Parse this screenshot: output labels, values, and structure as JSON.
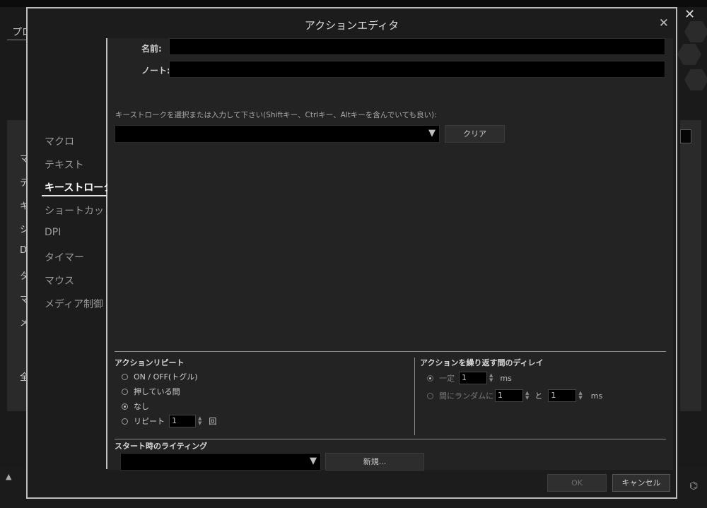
{
  "background": {
    "tab_partial": "プロ",
    "side_letters": [
      "マ",
      "テ",
      "キ",
      "シ",
      "D",
      "タ",
      "マ",
      "メ",
      "全"
    ],
    "close_glyph": "✕",
    "up_arrow": "▲"
  },
  "dialog": {
    "title": "アクションエディタ",
    "close_glyph": "✕"
  },
  "nav": {
    "items": [
      "マクロ",
      "テキスト",
      "キーストローク",
      "ショートカット",
      "DPI",
      "タイマー",
      "マウス",
      "メディア制御"
    ],
    "active_index": 2
  },
  "form": {
    "name_label": "名前:",
    "name_value": "",
    "note_label": "ノート:",
    "note_value": "",
    "keystroke_instruction": "キーストロークを選択または入力して下さい(Shiftキー、Ctrlキー、Altキーを含んでいても良い):",
    "keystroke_value": "",
    "clear_button": "クリア"
  },
  "repeat": {
    "title": "アクションリピート",
    "options": [
      "ON / OFF(トグル)",
      "押している間",
      "なし",
      "リピート"
    ],
    "selected_index": 2,
    "repeat_count": "1",
    "repeat_unit": "回"
  },
  "delay": {
    "title": "アクションを繰り返す間のディレイ",
    "fixed_label": "一定",
    "fixed_value": "1",
    "fixed_unit": "ms",
    "random_label": "間にランダムに",
    "random_from": "1",
    "random_and": "と",
    "random_to": "1",
    "random_unit": "ms",
    "selected": "fixed",
    "enabled": false
  },
  "lighting": {
    "title": "スタート時のライティング",
    "value": "",
    "new_button": "新規..."
  },
  "footer": {
    "ok_label": "OK",
    "cancel_label": "キャンセル"
  },
  "colors": {
    "dialog_bg": "#1c1c1c",
    "panel_bg": "#232323",
    "input_bg": "#000000",
    "border": "#bdbdbd"
  }
}
